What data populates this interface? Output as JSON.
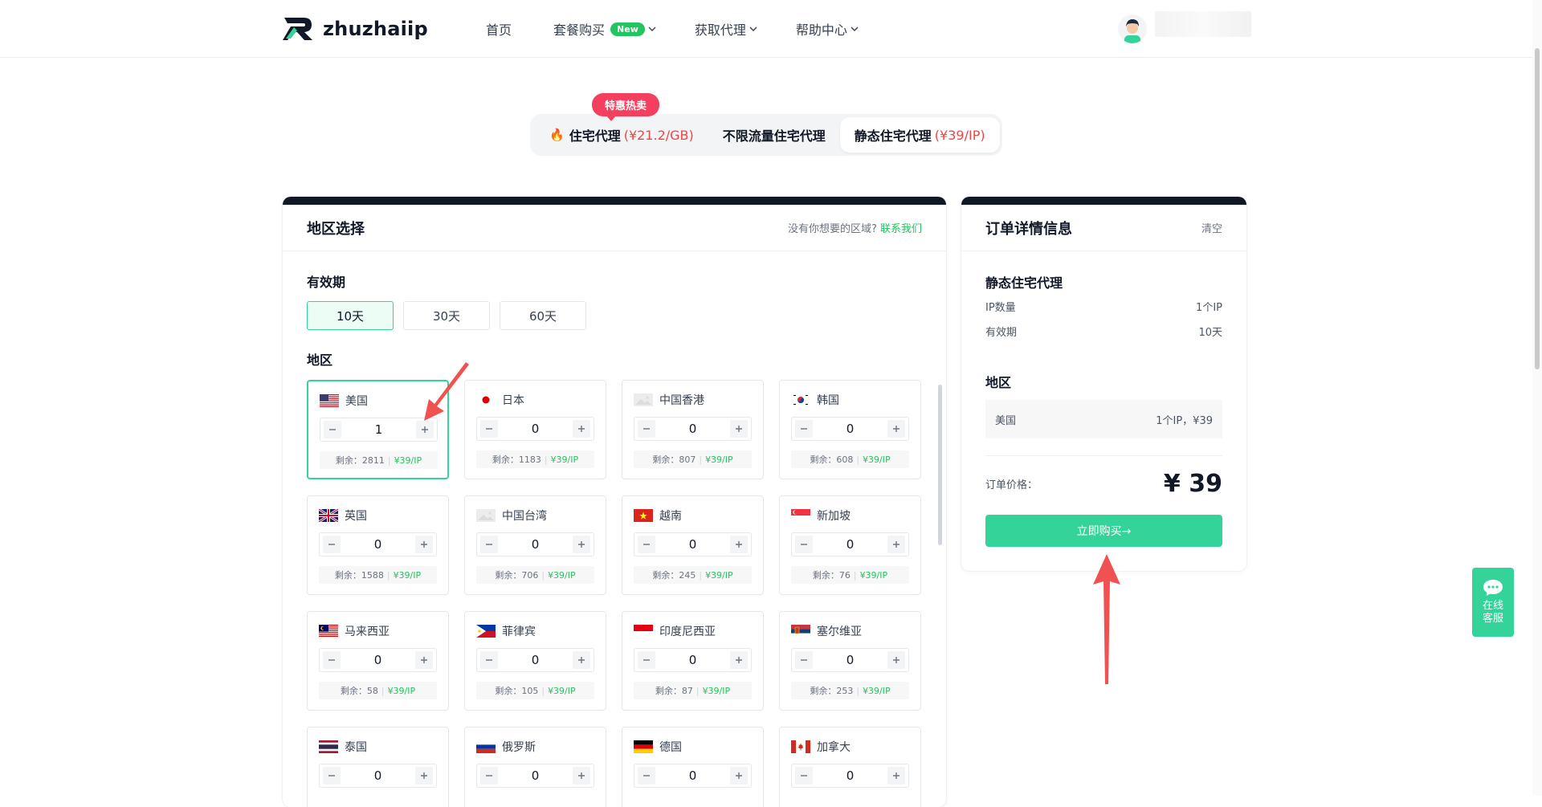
{
  "brand": {
    "name": "zhuzhaiip"
  },
  "nav": {
    "items": [
      {
        "label": "首页",
        "has_badge": false,
        "has_chevron": false
      },
      {
        "label": "套餐购买",
        "badge": "New",
        "has_chevron": true
      },
      {
        "label": "获取代理",
        "has_chevron": true
      },
      {
        "label": "帮助中心",
        "has_chevron": true
      }
    ]
  },
  "product_tabs": {
    "hot_badge": "特惠热卖",
    "tabs": [
      {
        "label": "住宅代理",
        "price": "(¥21.2/GB)",
        "icon": "fire-icon",
        "active": false
      },
      {
        "label": "不限流量住宅代理",
        "price": "",
        "active": false
      },
      {
        "label": "静态住宅代理",
        "price": "(¥39/IP)",
        "active": true
      }
    ]
  },
  "region_panel": {
    "title": "地区选择",
    "hint": "没有你想要的区域?",
    "contact_link": "联系我们",
    "period_label": "有效期",
    "periods": [
      "10天",
      "30天",
      "60天"
    ],
    "selected_period": "10天",
    "region_label": "地区",
    "remain_prefix": "剩余：",
    "unit_price": "¥39/IP",
    "regions": [
      {
        "name": "美国",
        "flag": "us",
        "qty": "1",
        "remain": "2811",
        "selected": true
      },
      {
        "name": "日本",
        "flag": "jp",
        "qty": "0",
        "remain": "1183"
      },
      {
        "name": "中国香港",
        "flag": "placeholder",
        "qty": "0",
        "remain": "807"
      },
      {
        "name": "韩国",
        "flag": "kr",
        "qty": "0",
        "remain": "608"
      },
      {
        "name": "英国",
        "flag": "gb",
        "qty": "0",
        "remain": "1588"
      },
      {
        "name": "中国台湾",
        "flag": "placeholder",
        "qty": "0",
        "remain": "706"
      },
      {
        "name": "越南",
        "flag": "vn",
        "qty": "0",
        "remain": "245"
      },
      {
        "name": "新加坡",
        "flag": "sg",
        "qty": "0",
        "remain": "76"
      },
      {
        "name": "马来西亚",
        "flag": "my",
        "qty": "0",
        "remain": "58"
      },
      {
        "name": "菲律宾",
        "flag": "ph",
        "qty": "0",
        "remain": "105"
      },
      {
        "name": "印度尼西亚",
        "flag": "id",
        "qty": "0",
        "remain": "87"
      },
      {
        "name": "塞尔维亚",
        "flag": "rs",
        "qty": "0",
        "remain": "253"
      },
      {
        "name": "泰国",
        "flag": "th",
        "qty": "0",
        "remain": ""
      },
      {
        "name": "俄罗斯",
        "flag": "ru",
        "qty": "0",
        "remain": ""
      },
      {
        "name": "德国",
        "flag": "de",
        "qty": "0",
        "remain": ""
      },
      {
        "name": "加拿大",
        "flag": "ca",
        "qty": "0",
        "remain": ""
      }
    ]
  },
  "order_panel": {
    "title": "订单详情信息",
    "clear": "清空",
    "product": "静态住宅代理",
    "ip_count_label": "IP数量",
    "ip_count": "1个IP",
    "period_label": "有效期",
    "period": "10天",
    "region_label": "地区",
    "region_name": "美国",
    "region_detail": "1个IP，¥39",
    "total_label": "订单价格：",
    "total": "¥ 39",
    "buy_button": "立即购买→"
  },
  "service": {
    "line1": "在线",
    "line2": "客服"
  },
  "colors": {
    "accent": "#34d399",
    "price_red": "#ef4444",
    "dark_bar": "#101828",
    "annotation_arrow": "#f05252"
  }
}
